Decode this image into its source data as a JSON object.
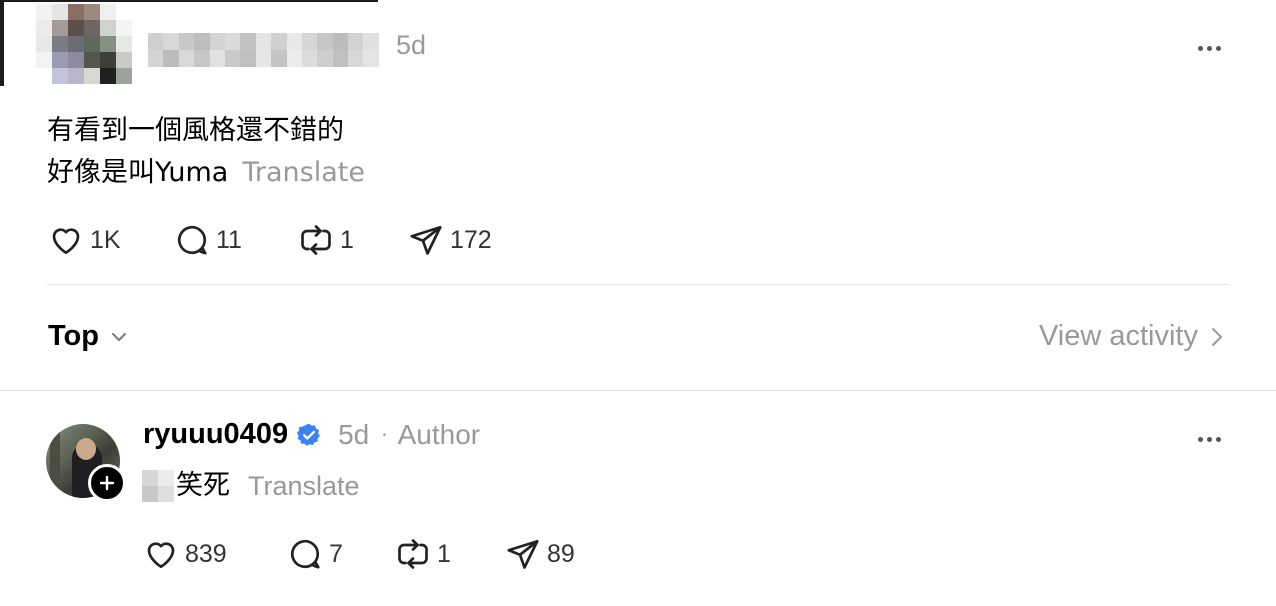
{
  "original_post": {
    "time": "5d",
    "lines": [
      "有看到一個風格還不錯的",
      "好像是叫Yuma"
    ],
    "translate": "Translate",
    "stats": {
      "likes": "1K",
      "replies": "11",
      "reposts": "1",
      "shares": "172"
    }
  },
  "sort": {
    "label": "Top",
    "icon": "chevron-down-icon"
  },
  "view_activity": {
    "label": "View activity",
    "icon": "chevron-right-icon"
  },
  "reply": {
    "username": "ryuuu0409",
    "verified": true,
    "time": "5d",
    "separator": "·",
    "tag": "Author",
    "text": "笑死",
    "translate": "Translate",
    "stats": {
      "likes": "839",
      "replies": "7",
      "reposts": "1",
      "shares": "89"
    }
  },
  "colors": {
    "muted": "#999999",
    "verified": "#3b82f6",
    "divider": "#e2e2e2"
  }
}
